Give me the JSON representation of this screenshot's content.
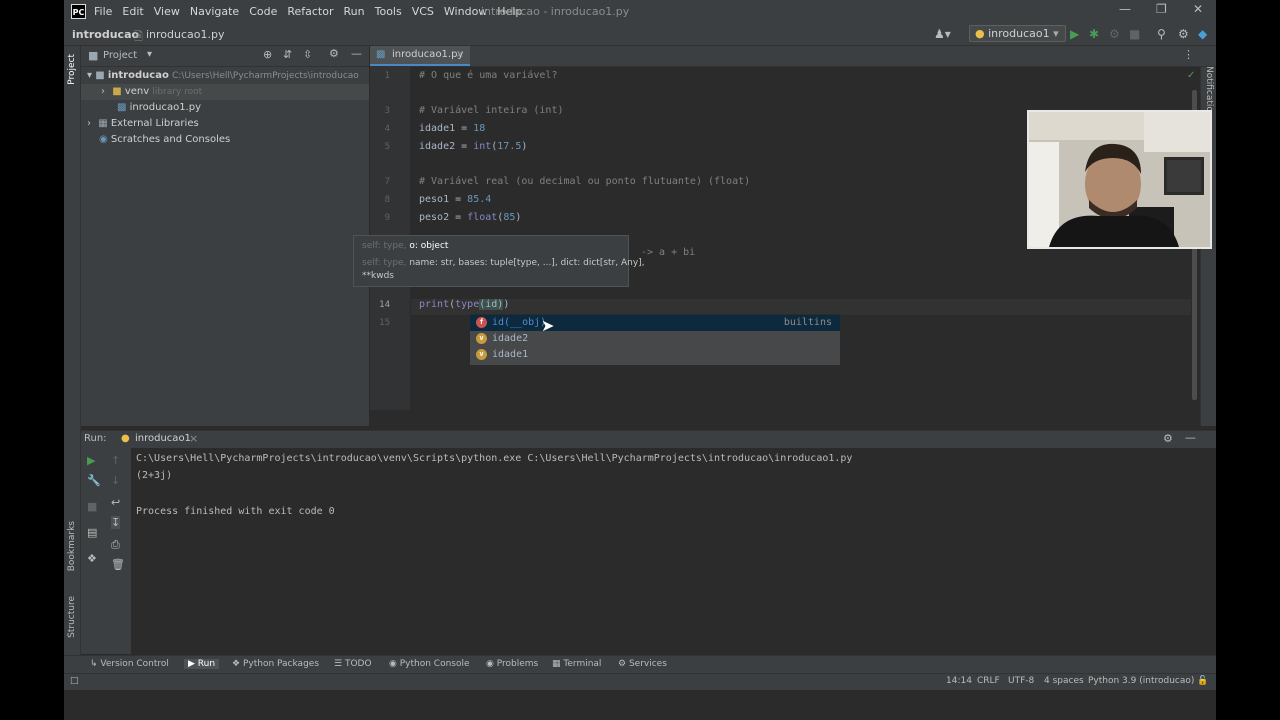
{
  "app": {
    "logo": "PC",
    "window_title": "introducao - inroducao1.py"
  },
  "menu": [
    "File",
    "Edit",
    "View",
    "Navigate",
    "Code",
    "Refactor",
    "Run",
    "Tools",
    "VCS",
    "Window",
    "Help"
  ],
  "breadcrumb": {
    "project": "introducao",
    "file": "inroducao1.py"
  },
  "run_config": {
    "name": "inroducao1"
  },
  "project_panel": {
    "title": "Project",
    "root": {
      "name": "introducao",
      "path": "C:\\Users\\Hell\\PycharmProjects\\introducao"
    },
    "venv": {
      "name": "venv",
      "hint": "library root"
    },
    "file": "inroducao1.py",
    "external": "External Libraries",
    "scratches": "Scratches and Consoles"
  },
  "side_labels": {
    "project": "Project",
    "bookmarks": "Bookmarks",
    "structure": "Structure",
    "notifications": "Notifications"
  },
  "editor": {
    "tab": "inroducao1.py",
    "line_numbers": [
      "1",
      "2",
      "3",
      "4",
      "5",
      "6",
      "7",
      "8",
      "9",
      "14",
      "15"
    ],
    "lines": {
      "l1": "# O que é uma variável?",
      "l3": "# Variável inteira (int)",
      "l4a": "idade1 = ",
      "l4b": "18",
      "l5a": "idade2 = ",
      "l5b": "int",
      "l5c": "(",
      "l5d": "17.5",
      "l5e": ")",
      "l7": "# Variável real (ou decimal ou ponto flutuante) (float)",
      "l8a": "peso1 = ",
      "l8b": "85.4",
      "l9a": "peso2 = ",
      "l9b": "float",
      "l9c": "(",
      "l9d": "85",
      "l9e": ")",
      "l12": "-> a + bi",
      "l14a": "print",
      "l14b": "(",
      "l14c": "type",
      "l14d": "(id)",
      "l14e": ")"
    }
  },
  "param_hint": {
    "line1_dim": "self: type,",
    "line1": "o: object",
    "line2_dim": "self: type,",
    "line2": "name: str, bases: tuple[type, ...], dict: dict[str, Any],",
    "line3": "**kwds"
  },
  "completion": {
    "items": [
      {
        "icon": "f",
        "text": "id(__obj)",
        "source": "builtins",
        "color": "#c75450"
      },
      {
        "icon": "v",
        "text": "idade2",
        "source": "",
        "color": "#c79a3d"
      },
      {
        "icon": "v",
        "text": "idade1",
        "source": "",
        "color": "#c79a3d"
      }
    ]
  },
  "run_panel": {
    "label": "Run:",
    "tab": "inroducao1",
    "output": [
      "C:\\Users\\Hell\\PycharmProjects\\introducao\\venv\\Scripts\\python.exe C:\\Users\\Hell\\PycharmProjects\\introducao\\inroducao1.py",
      "(2+3j)",
      "",
      "Process finished with exit code 0"
    ]
  },
  "bottom_tabs": [
    "Version Control",
    "Run",
    "Python Packages",
    "TODO",
    "Python Console",
    "Problems",
    "Terminal",
    "Services"
  ],
  "status": {
    "position": "14:14",
    "line_sep": "CRLF",
    "encoding": "UTF-8",
    "indent": "4 spaces",
    "interpreter": "Python 3.9 (introducao)"
  },
  "colors": {
    "accent": "#4a88c7",
    "run_green": "#499c54",
    "comment": "#808080",
    "number": "#6897bb"
  }
}
